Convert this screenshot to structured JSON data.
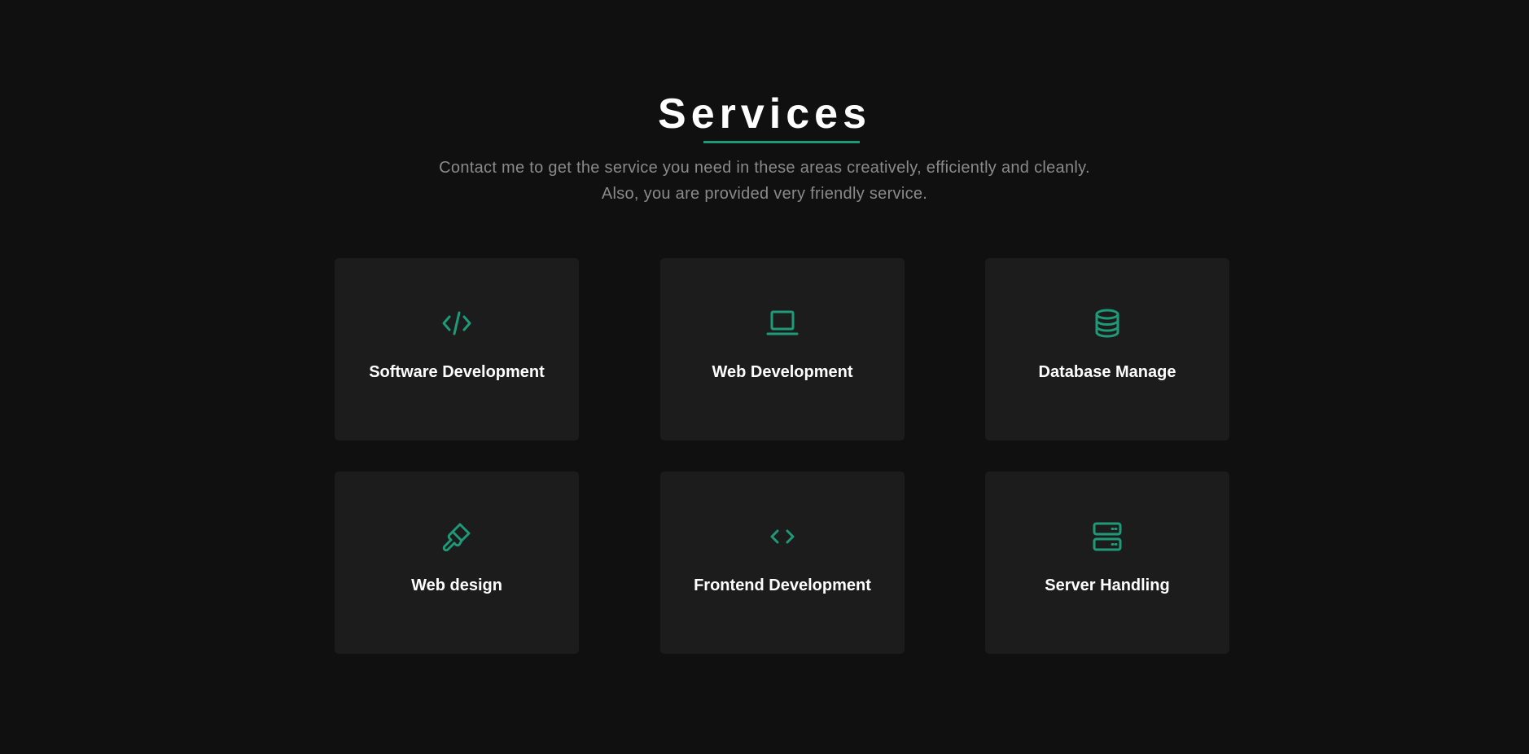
{
  "section": {
    "title": "Services",
    "subtitle": "Contact me to get the service you need in these areas creatively, efficiently and cleanly. Also, you are provided very friendly service."
  },
  "colors": {
    "background": "#101010",
    "card": "#1c1c1c",
    "accent": "#1f9a78",
    "text": "#ffffff",
    "muted": "#8a8a8a"
  },
  "services": [
    {
      "label": "Software Development",
      "icon": "code-slash-icon"
    },
    {
      "label": "Web Development",
      "icon": "laptop-icon"
    },
    {
      "label": "Database Manage",
      "icon": "database-icon"
    },
    {
      "label": "Web design",
      "icon": "paint-brush-icon"
    },
    {
      "label": "Frontend Development",
      "icon": "code-brackets-icon"
    },
    {
      "label": "Server Handling",
      "icon": "server-icon"
    }
  ]
}
